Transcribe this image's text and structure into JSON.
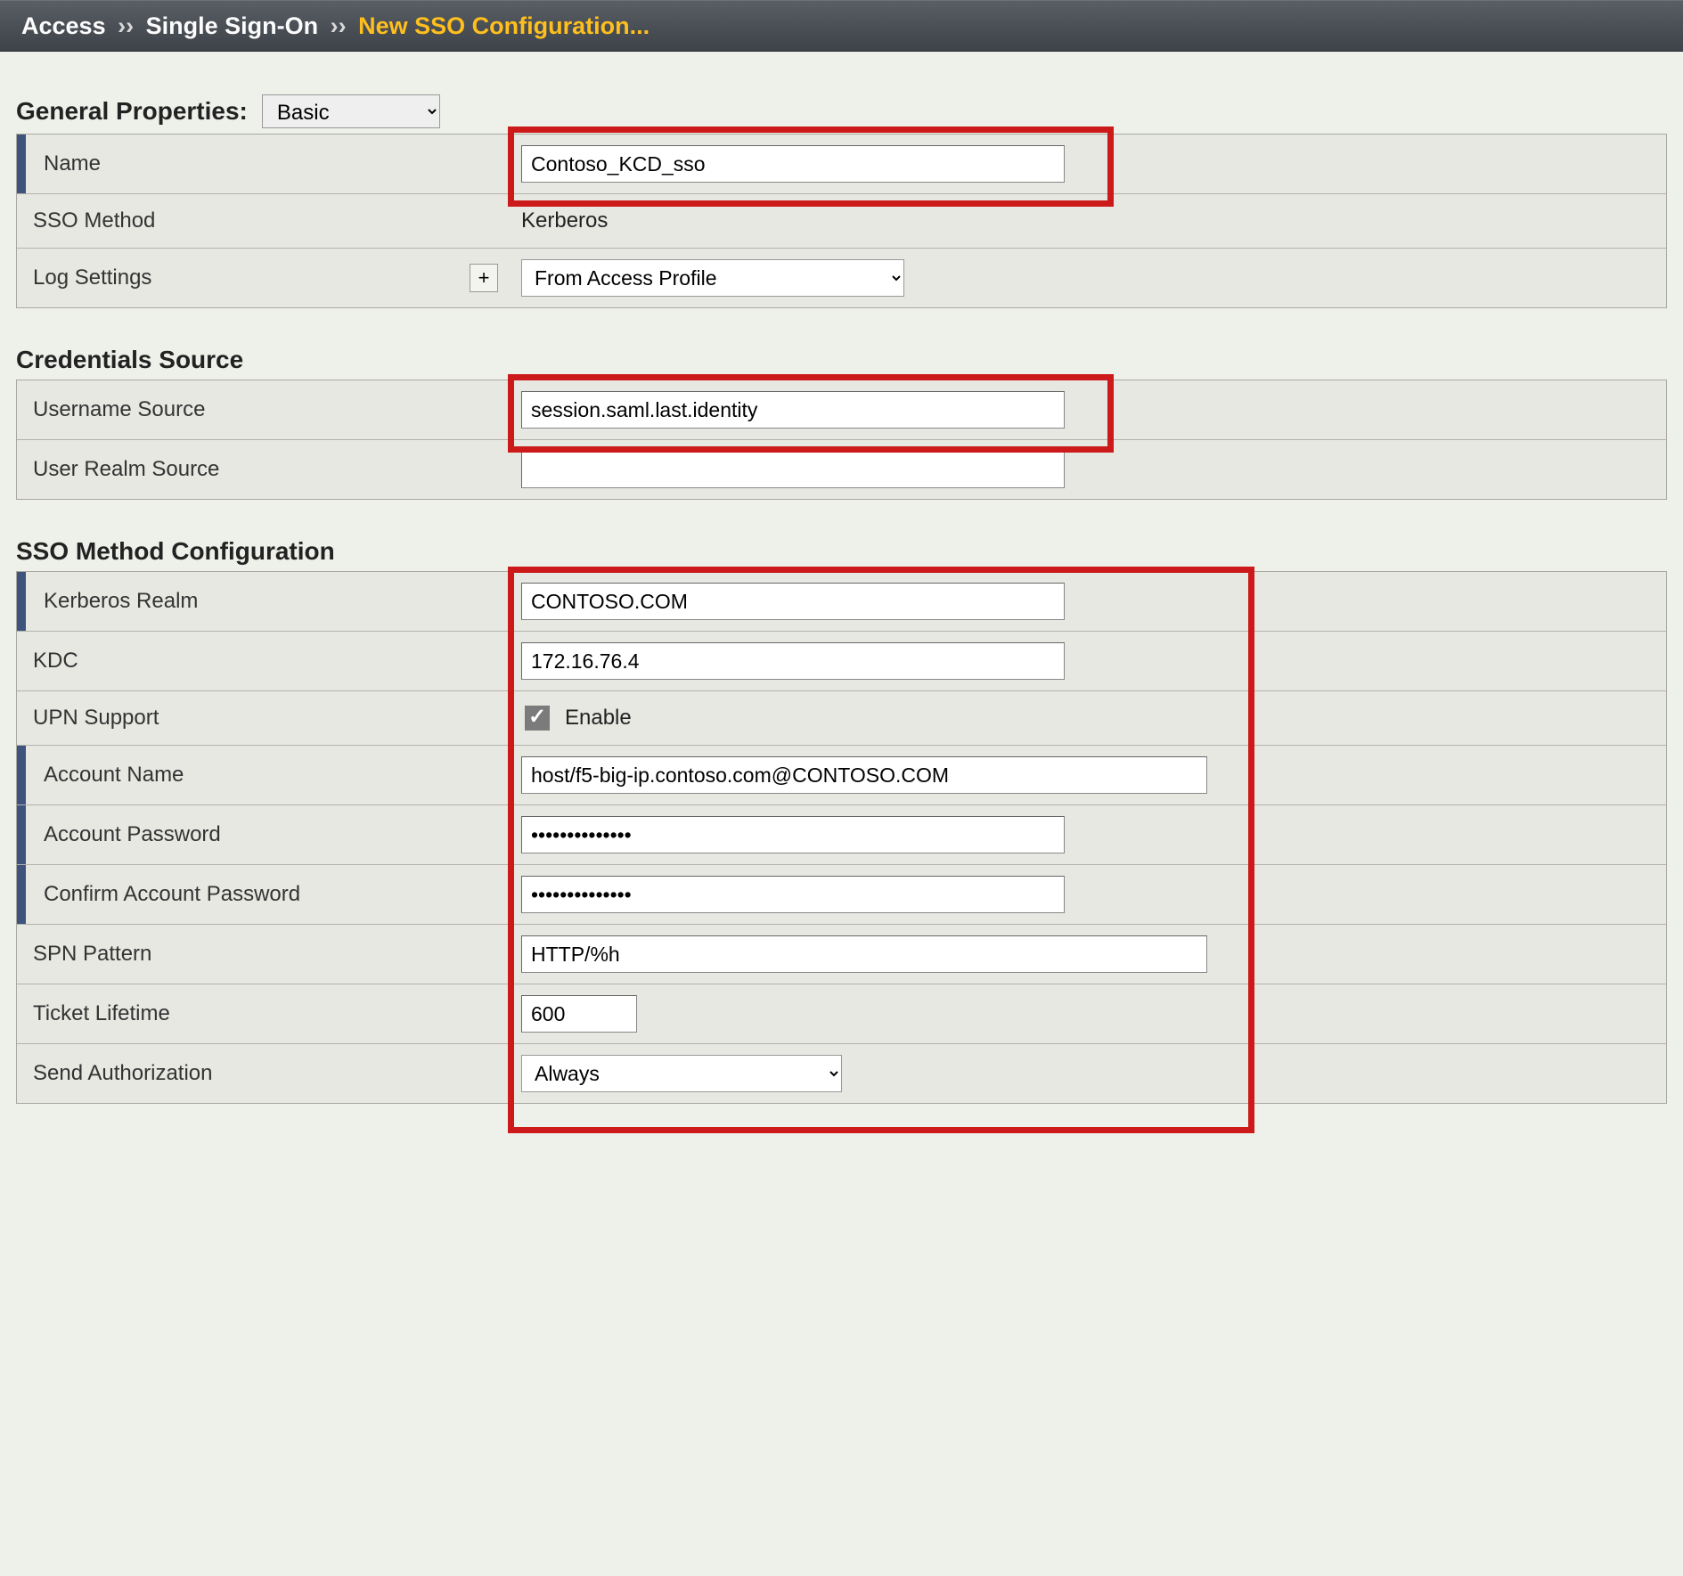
{
  "breadcrumb": {
    "item1": "Access",
    "sep": "››",
    "item2": "Single Sign-On",
    "current": "New SSO Configuration..."
  },
  "sections": {
    "general": {
      "title": "General Properties:",
      "mode": "Basic",
      "rows": {
        "name": {
          "label": "Name",
          "value": "Contoso_KCD_sso"
        },
        "sso_method": {
          "label": "SSO Method",
          "value": "Kerberos"
        },
        "log_settings": {
          "label": "Log Settings",
          "plus": "+",
          "value": "From Access Profile"
        }
      }
    },
    "credentials": {
      "title": "Credentials Source",
      "rows": {
        "username_source": {
          "label": "Username Source",
          "value": "session.saml.last.identity"
        },
        "user_realm_source": {
          "label": "User Realm Source",
          "value": ""
        }
      }
    },
    "sso_config": {
      "title": "SSO Method Configuration",
      "rows": {
        "kerberos_realm": {
          "label": "Kerberos Realm",
          "value": "CONTOSO.COM"
        },
        "kdc": {
          "label": "KDC",
          "value": "172.16.76.4"
        },
        "upn_support": {
          "label": "UPN Support",
          "cb_label": "Enable",
          "checked": true
        },
        "account_name": {
          "label": "Account Name",
          "value": "host/f5-big-ip.contoso.com@CONTOSO.COM"
        },
        "account_password": {
          "label": "Account Password",
          "value": "••••••••••••••"
        },
        "confirm_account_password": {
          "label": "Confirm Account Password",
          "value": "••••••••••••••"
        },
        "spn_pattern": {
          "label": "SPN Pattern",
          "value": "HTTP/%h"
        },
        "ticket_lifetime": {
          "label": "Ticket Lifetime",
          "value": "600"
        },
        "send_authorization": {
          "label": "Send Authorization",
          "value": "Always"
        }
      }
    }
  }
}
